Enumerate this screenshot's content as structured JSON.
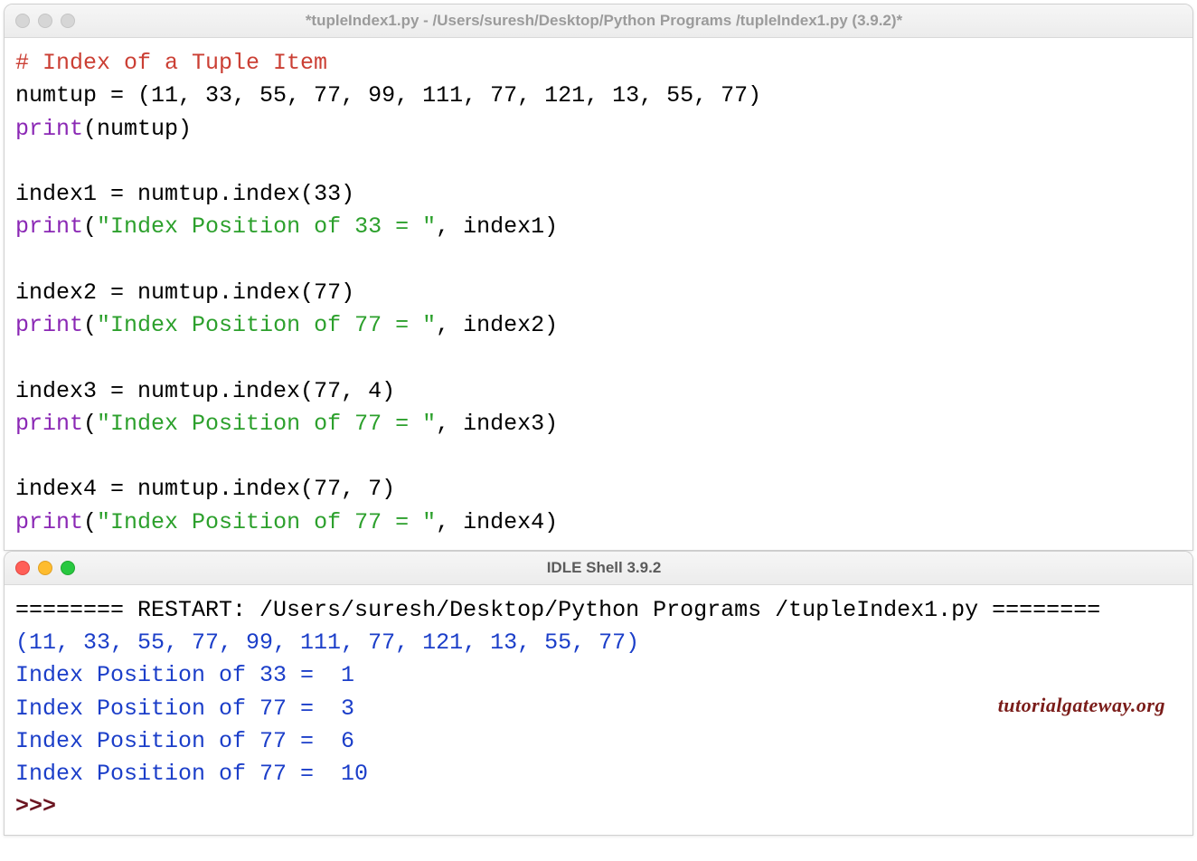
{
  "editor": {
    "title": "*tupleIndex1.py - /Users/suresh/Desktop/Python Programs /tupleIndex1.py (3.9.2)*",
    "lines": {
      "l1_comment": "# Index of a Tuple Item",
      "l2_a": "numtup = (",
      "l2_b": "11, 33, 55, 77, 99, 111, 77, 121, 13, 55, 77",
      "l2_c": ")",
      "l3_a": "print",
      "l3_b": "(numtup)",
      "l5_a": "index1 = numtup.index(",
      "l5_b": "33",
      "l5_c": ")",
      "l6_a": "print",
      "l6_b": "(",
      "l6_c": "\"Index Position of 33 = \"",
      "l6_d": ", index1)",
      "l8_a": "index2 = numtup.index(",
      "l8_b": "77",
      "l8_c": ")",
      "l9_a": "print",
      "l9_b": "(",
      "l9_c": "\"Index Position of 77 = \"",
      "l9_d": ", index2)",
      "l11_a": "index3 = numtup.index(",
      "l11_b": "77, 4",
      "l11_c": ")",
      "l12_a": "print",
      "l12_b": "(",
      "l12_c": "\"Index Position of 77 = \"",
      "l12_d": ", index3)",
      "l14_a": "index4 = numtup.index(",
      "l14_b": "77, 7",
      "l14_c": ")",
      "l15_a": "print",
      "l15_b": "(",
      "l15_c": "\"Index Position of 77 = \"",
      "l15_d": ", index4)"
    }
  },
  "shell": {
    "title": "IDLE Shell 3.9.2",
    "restart_line": "======== RESTART: /Users/suresh/Desktop/Python Programs /tupleIndex1.py ========",
    "out1": "(11, 33, 55, 77, 99, 111, 77, 121, 13, 55, 77)",
    "out2": "Index Position of 33 =  1",
    "out3": "Index Position of 77 =  3",
    "out4": "Index Position of 77 =  6",
    "out5": "Index Position of 77 =  10",
    "prompt": ">>> "
  },
  "watermark": "tutorialgateway.org"
}
